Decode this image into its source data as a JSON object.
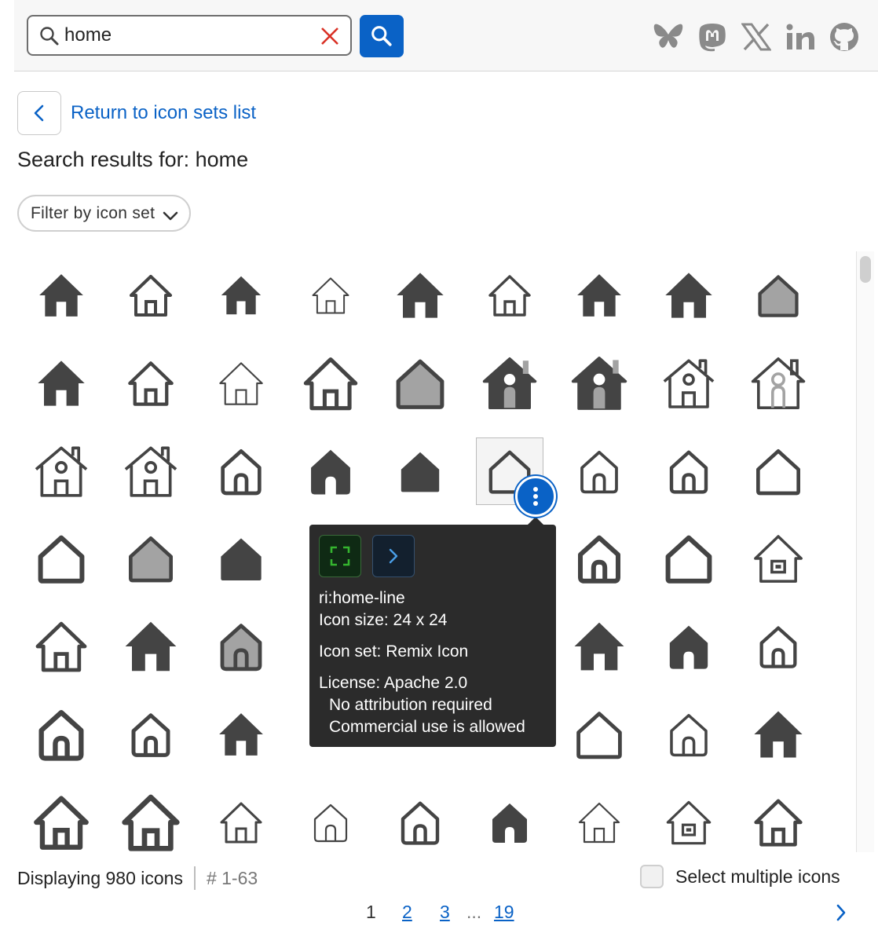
{
  "search": {
    "value": "home",
    "placeholder": "Search icons"
  },
  "colors": {
    "accent": "#0a62c6",
    "icon": "#444444",
    "icon_light": "#a3a3a3",
    "clear": "#d93025",
    "tooltip_bg": "#2b2b2b"
  },
  "social": [
    "bluesky-icon",
    "mastodon-icon",
    "x-icon",
    "linkedin-icon",
    "github-icon"
  ],
  "nav": {
    "back_label": "Return to icon sets list"
  },
  "results": {
    "heading": "Search results for: home"
  },
  "filter": {
    "label": "Filter by icon set"
  },
  "tooltip": {
    "icon_name": "ri:home-line",
    "size": "Icon size: 24 x 24",
    "set": "Icon set: Remix Icon",
    "license": "License: Apache 2.0",
    "attribution": "No attribution required",
    "commercial": "Commercial use is allowed"
  },
  "footer": {
    "count": "Displaying 980 icons",
    "range": "# 1-63",
    "multi_select_label": "Select multiple icons"
  },
  "pagination": {
    "current": "1",
    "pages": [
      "2",
      "3"
    ],
    "ellipsis": "...",
    "last": "19"
  }
}
